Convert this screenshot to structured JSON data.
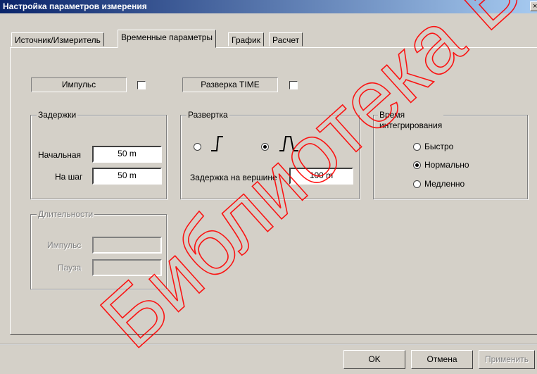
{
  "window": {
    "title": "Настройка параметров измерения",
    "close_glyph": "×"
  },
  "tabs": [
    {
      "label": "Источник/Измеритель"
    },
    {
      "label": "Временные параметры",
      "active": true
    },
    {
      "label": "График"
    },
    {
      "label": "Расчет"
    }
  ],
  "top_row": {
    "impulse_label": "Импульс",
    "impulse_checked": false,
    "sweep_time_label": "Разверка TIME",
    "sweep_time_checked": false
  },
  "delays": {
    "title": "Задержки",
    "initial_label": "Начальная",
    "initial_value": "50 m",
    "step_label": "На шаг",
    "step_value": "50 m"
  },
  "sweep": {
    "title": "Развертка",
    "mode_step_selected": false,
    "mode_pulse_selected": true,
    "step_icon": "step-waveform-icon",
    "pulse_icon": "pulse-waveform-icon",
    "top_delay_label": "Задержка на  вершине",
    "top_delay_value": "100 m"
  },
  "integration": {
    "title_line1": "Время",
    "title_line2": "интегрирования",
    "options": [
      {
        "label": "Быстро",
        "selected": false
      },
      {
        "label": "Нормально",
        "selected": true
      },
      {
        "label": "Медленно",
        "selected": false
      }
    ]
  },
  "durations": {
    "title": "Длительности",
    "impulse_label": "Импульс",
    "impulse_value": "",
    "pause_label": "Пауза",
    "pause_value": ""
  },
  "footer": {
    "ok_label": "OK",
    "cancel_label": "Отмена",
    "apply_label": "Применить"
  },
  "watermark": {
    "text": "Библиотека БГУИР",
    "color": "#ff0000"
  }
}
